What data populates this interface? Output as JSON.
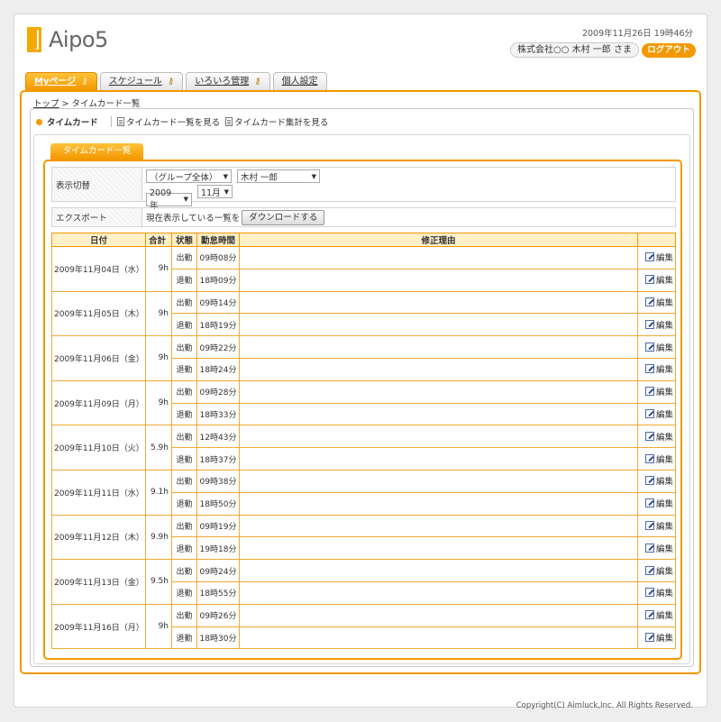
{
  "header": {
    "logo_text": "Aipo5",
    "datetime": "2009年11月26日 19時46分",
    "user": "株式会社○○ 木村 一郎 さま",
    "logout": "ログアウト"
  },
  "tabs": [
    {
      "label": "Myページ",
      "icon": "key-icon",
      "active": true
    },
    {
      "label": "スケジュール",
      "icon": "key-icon",
      "active": false
    },
    {
      "label": "いろいろ管理",
      "icon": "key-icon",
      "active": false
    },
    {
      "label": "個人設定",
      "icon": "",
      "active": false
    }
  ],
  "breadcrumb": {
    "top": "トップ",
    "sep": ">",
    "current": "タイムカード一覧"
  },
  "toolbar": {
    "title": "タイムカード",
    "link_list": "タイムカード一覧を見る",
    "link_summary": "タイムカード集計を見る"
  },
  "subtab": "タイムカード一覧",
  "filter": {
    "label": "表示切替",
    "group": "（グループ全体）",
    "user": "木村 一郎",
    "year": "2009年",
    "month": "11月"
  },
  "export": {
    "label": "エクスポート",
    "text": "現在表示している一覧を",
    "button": "ダウンロードする"
  },
  "table": {
    "headers": {
      "date": "日付",
      "total": "合計",
      "state": "状態",
      "time": "勤怠時間",
      "reason": "修正理由"
    },
    "in_label": "出勤",
    "out_label": "退勤",
    "edit_label": "編集",
    "rows": [
      {
        "date": "2009年11月04日（水）",
        "total": "9h",
        "in": "09時08分",
        "out": "18時09分"
      },
      {
        "date": "2009年11月05日（木）",
        "total": "9h",
        "in": "09時14分",
        "out": "18時19分"
      },
      {
        "date": "2009年11月06日（金）",
        "total": "9h",
        "in": "09時22分",
        "out": "18時24分"
      },
      {
        "date": "2009年11月09日（月）",
        "total": "9h",
        "in": "09時28分",
        "out": "18時33分"
      },
      {
        "date": "2009年11月10日（火）",
        "total": "5.9h",
        "in": "12時43分",
        "out": "18時37分"
      },
      {
        "date": "2009年11月11日（水）",
        "total": "9.1h",
        "in": "09時38分",
        "out": "18時50分"
      },
      {
        "date": "2009年11月12日（木）",
        "total": "9.9h",
        "in": "09時19分",
        "out": "19時18分"
      },
      {
        "date": "2009年11月13日（金）",
        "total": "9.5h",
        "in": "09時24分",
        "out": "18時55分"
      },
      {
        "date": "2009年11月16日（月）",
        "total": "9h",
        "in": "09時26分",
        "out": "18時30分"
      }
    ]
  },
  "footer": "Copyright(C) Aimluck,Inc. All Rights Reserved."
}
